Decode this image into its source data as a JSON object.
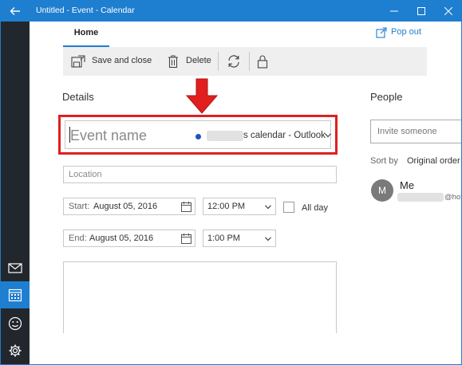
{
  "window": {
    "title": "Untitled - Event - Calendar",
    "accent_color": "#1e7ed0",
    "rail_color": "#22272d"
  },
  "nav_rail": {
    "items": [
      {
        "name": "mail",
        "icon": "mail-icon",
        "active": false
      },
      {
        "name": "calendar",
        "icon": "calendar-icon",
        "active": true
      },
      {
        "name": "feedback",
        "icon": "smiley-icon",
        "active": false
      },
      {
        "name": "settings",
        "icon": "gear-icon",
        "active": false
      }
    ]
  },
  "ribbon": {
    "tab_label": "Home",
    "popout_label": "Pop out",
    "save_label": "Save and close",
    "delete_label": "Delete"
  },
  "details": {
    "heading": "Details",
    "event_name_placeholder": "Event name",
    "calendar_label": "s calendar - Outlook",
    "calendar_dot_color": "#1e55b8",
    "location_placeholder": "Location",
    "start_label": "Start:",
    "start_date": "August 05, 2016",
    "start_time": "12:00 PM",
    "end_label": "End:",
    "end_date": "August 05, 2016",
    "end_time": "1:00 PM",
    "all_day_label": "All day",
    "all_day_checked": false,
    "highlight_color": "#e11f1f"
  },
  "people": {
    "heading": "People",
    "invite_placeholder": "Invite someone",
    "sort_label": "Sort by",
    "sort_value": "Original order",
    "attendee_initial": "M",
    "attendee_name": "Me",
    "attendee_email_suffix": "@hot"
  }
}
